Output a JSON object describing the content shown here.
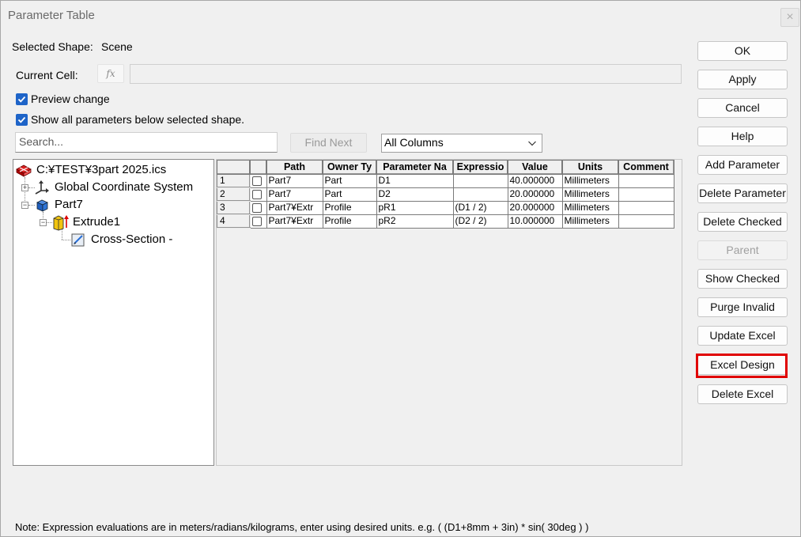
{
  "window": {
    "title": "Parameter Table",
    "close_glyph": "×"
  },
  "selected_shape": {
    "label": "Selected Shape:",
    "value": "Scene"
  },
  "current_cell": {
    "label": "Current Cell:",
    "fx_label": "fx",
    "formula": ""
  },
  "options": {
    "preview_change": "Preview change",
    "show_all": "Show all parameters below selected shape."
  },
  "search": {
    "placeholder": "Search...",
    "find_next": "Find Next"
  },
  "columns_select": {
    "selected": "All Columns"
  },
  "tree": {
    "root": "C:¥TEST¥3part 2025.ics",
    "gcs": "Global Coordinate System",
    "part": "Part7",
    "extrude": "Extrude1",
    "cross_section": "Cross-Section -"
  },
  "grid": {
    "headers": [
      "Path",
      "Owner Ty",
      "Parameter Na",
      "Expressio",
      "Value",
      "Units",
      "Comment"
    ],
    "rows": [
      {
        "num": "1",
        "path": "Part7",
        "owner": "Part",
        "param": "D1",
        "expr": "",
        "value": "40.000000",
        "units": "Millimeters",
        "comment": ""
      },
      {
        "num": "2",
        "path": "Part7",
        "owner": "Part",
        "param": "D2",
        "expr": "",
        "value": "20.000000",
        "units": "Millimeters",
        "comment": ""
      },
      {
        "num": "3",
        "path": "Part7¥Extr",
        "owner": "Profile",
        "param": "pR1",
        "expr": "(D1 / 2)",
        "value": "20.000000",
        "units": "Millimeters",
        "comment": ""
      },
      {
        "num": "4",
        "path": "Part7¥Extr",
        "owner": "Profile",
        "param": "pR2",
        "expr": "(D2 / 2)",
        "value": "10.000000",
        "units": "Millimeters",
        "comment": ""
      }
    ]
  },
  "buttons": {
    "ok": "OK",
    "apply": "Apply",
    "cancel": "Cancel",
    "help": "Help",
    "add_parameter": "Add Parameter",
    "delete_parameter": "Delete Parameter",
    "delete_checked": "Delete Checked",
    "parent": "Parent",
    "show_checked": "Show Checked",
    "purge_invalid": "Purge Invalid",
    "update_excel": "Update Excel",
    "excel_design": "Excel Design",
    "delete_excel": "Delete Excel"
  },
  "colors": {
    "highlight": "#e00000",
    "checkbox_accent": "#1e64c8"
  },
  "note": "Note: Expression evaluations are in meters/radians/kilograms, enter using desired units. e.g. ( (D1+8mm + 3in) * sin( 30deg ) )"
}
